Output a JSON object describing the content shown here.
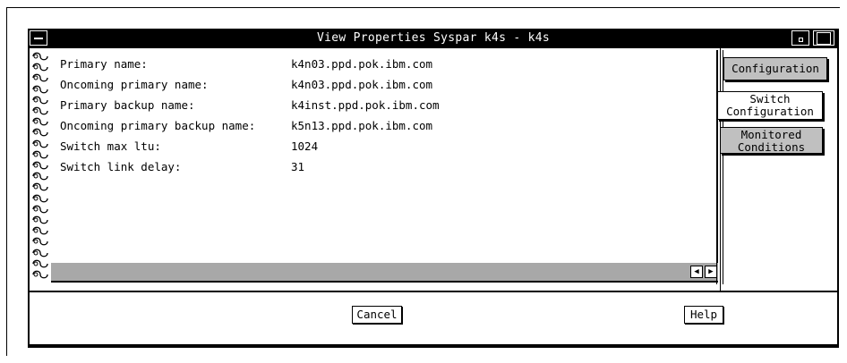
{
  "window": {
    "title": "View Properties Syspar k4s - k4s"
  },
  "properties": [
    {
      "label": "Primary name:",
      "value": "k4n03.ppd.pok.ibm.com"
    },
    {
      "label": "Oncoming primary name:",
      "value": "k4n03.ppd.pok.ibm.com"
    },
    {
      "label": "Primary backup name:",
      "value": "k4inst.ppd.pok.ibm.com"
    },
    {
      "label": "Oncoming primary backup name:",
      "value": "k5n13.ppd.pok.ibm.com"
    },
    {
      "label": "Switch max ltu:",
      "value": "1024"
    },
    {
      "label": "Switch link delay:",
      "value": "31"
    }
  ],
  "tabs": {
    "configuration": "Configuration",
    "switch_configuration_line1": "Switch",
    "switch_configuration_line2": "Configuration",
    "monitored_conditions_line1": "Monitored",
    "monitored_conditions_line2": "Conditions"
  },
  "scroll": {
    "left_arrow": "◀",
    "right_arrow": "▶"
  },
  "buttons": {
    "cancel": "Cancel",
    "help": "Help"
  },
  "icons": {
    "system_menu": "system-menu-icon",
    "minimize": "minimize-icon",
    "maximize": "maximize-icon",
    "spiral": "spiral-binding-icon"
  },
  "colors": {
    "titlebar": "#000000",
    "tab_background": "#c0c0c0",
    "page_footer": "#a8a8a8"
  }
}
